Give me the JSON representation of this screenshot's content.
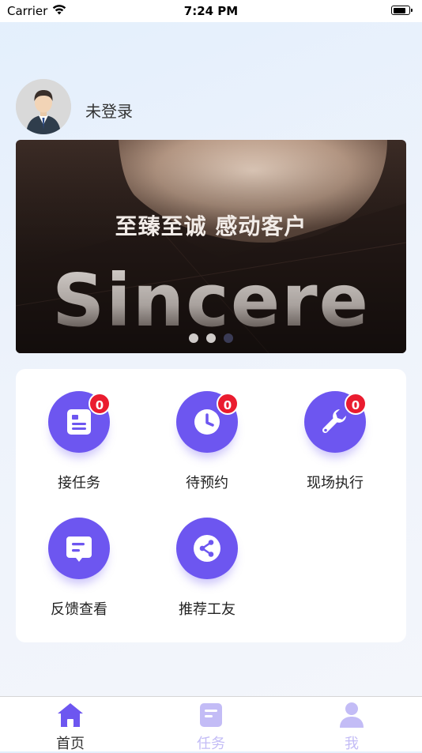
{
  "status_bar": {
    "carrier": "Carrier",
    "time": "7:24 PM",
    "battery_level": 0.85
  },
  "profile": {
    "avatar_icon": "user-avatar-icon",
    "username": "未登录"
  },
  "banner": {
    "slogan": "至臻至诚 感动客户",
    "big_text": "Sincere",
    "slide_count": 3,
    "active_slide": 3
  },
  "menu": {
    "items": [
      {
        "label": "接任务",
        "icon": "task-document-icon",
        "badge": "0"
      },
      {
        "label": "待预约",
        "icon": "clock-icon",
        "badge": "0"
      },
      {
        "label": "现场执行",
        "icon": "wrench-icon",
        "badge": "0"
      },
      {
        "label": "反馈查看",
        "icon": "message-icon"
      },
      {
        "label": "推荐工友",
        "icon": "share-icon"
      }
    ]
  },
  "tabbar": {
    "tabs": [
      {
        "label": "首页",
        "icon": "home-icon",
        "active": true
      },
      {
        "label": "任务",
        "icon": "task-icon",
        "active": false
      },
      {
        "label": "我",
        "icon": "profile-icon",
        "active": false
      }
    ]
  },
  "colors": {
    "accent": "#6d56f0",
    "badge": "#ea1c2f",
    "tab_active": "#6d56f0",
    "tab_inactive": "#c3bcf6"
  }
}
